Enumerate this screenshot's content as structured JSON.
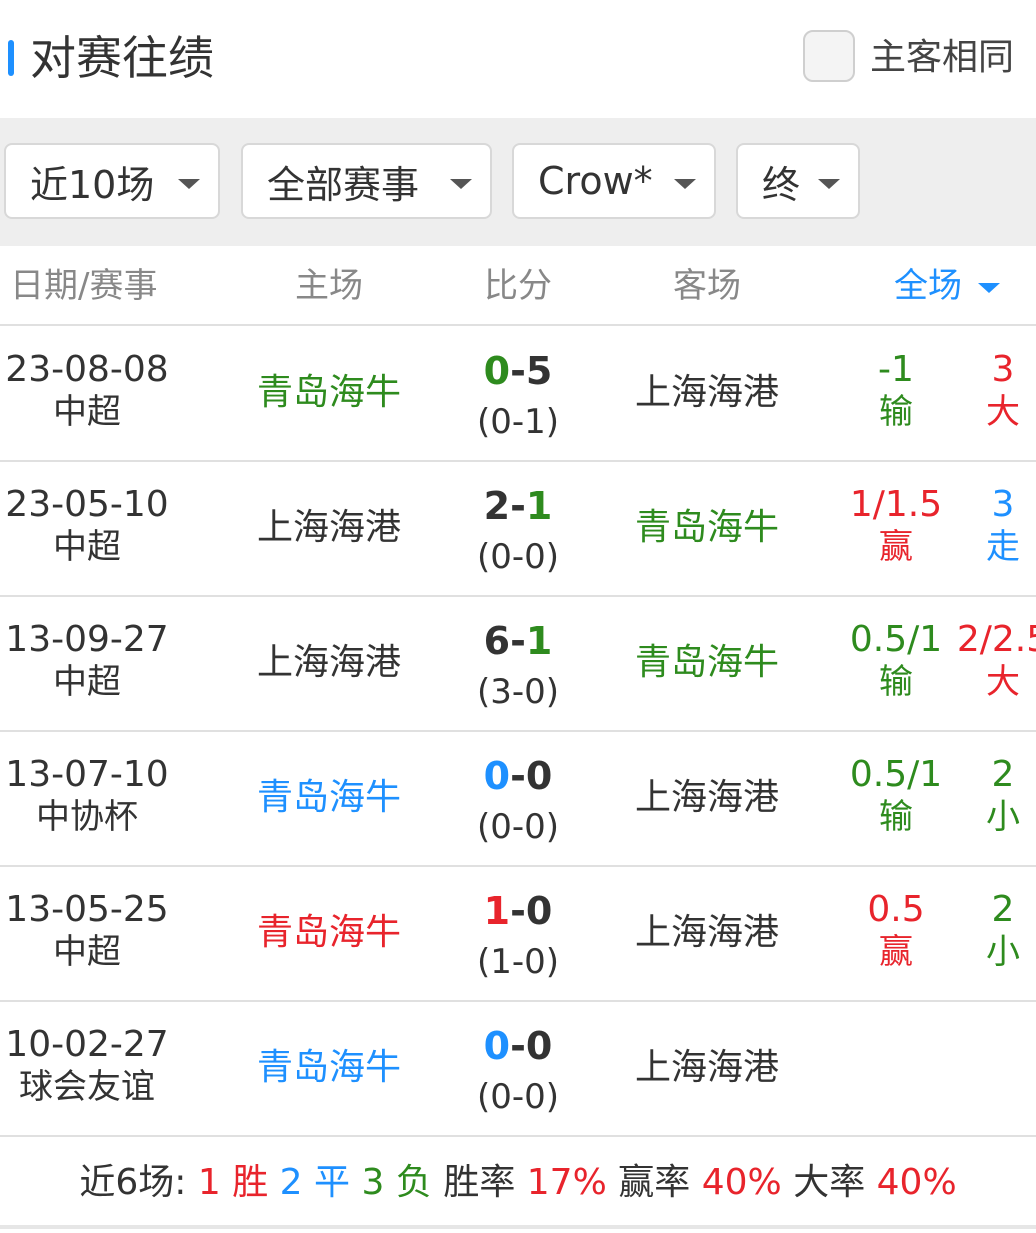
{
  "header": {
    "title": "对赛往绩",
    "checkbox_label": "主客相同"
  },
  "filters": {
    "count": "近10场",
    "competition": "全部赛事",
    "company": "Crow*",
    "odds_type": "终"
  },
  "table": {
    "columns": {
      "date_comp": "日期/赛事",
      "home": "主场",
      "score": "比分",
      "away": "客场",
      "period": "全场"
    },
    "rows": [
      {
        "date": "23-08-08",
        "comp": "中超",
        "home": "青岛海牛",
        "home_color": "#2e8b1e",
        "score_home": "0",
        "score_home_color": "#2e8b1e",
        "score_sep": "-",
        "score_away": "5",
        "score_away_color": "#333333",
        "half": "(0-1)",
        "away": "上海海港",
        "away_color": "#333333",
        "hcp": "-1",
        "hcp_color": "#2e8b1e",
        "hcp_result": "输",
        "hcp_result_color": "#2e8b1e",
        "ou": "3",
        "ou_color": "#e8242c",
        "ou_result": "大",
        "ou_result_color": "#e8242c"
      },
      {
        "date": "23-05-10",
        "comp": "中超",
        "home": "上海海港",
        "home_color": "#333333",
        "score_home": "2",
        "score_home_color": "#333333",
        "score_sep": "-",
        "score_away": "1",
        "score_away_color": "#2e8b1e",
        "half": "(0-0)",
        "away": "青岛海牛",
        "away_color": "#2e8b1e",
        "hcp": "1/1.5",
        "hcp_color": "#e8242c",
        "hcp_result": "赢",
        "hcp_result_color": "#e8242c",
        "ou": "3",
        "ou_color": "#1e90ff",
        "ou_result": "走",
        "ou_result_color": "#1e90ff"
      },
      {
        "date": "13-09-27",
        "comp": "中超",
        "home": "上海海港",
        "home_color": "#333333",
        "score_home": "6",
        "score_home_color": "#333333",
        "score_sep": "-",
        "score_away": "1",
        "score_away_color": "#2e8b1e",
        "half": "(3-0)",
        "away": "青岛海牛",
        "away_color": "#2e8b1e",
        "hcp": "0.5/1",
        "hcp_color": "#2e8b1e",
        "hcp_result": "输",
        "hcp_result_color": "#2e8b1e",
        "ou": "2/2.5",
        "ou_color": "#e8242c",
        "ou_result": "大",
        "ou_result_color": "#e8242c"
      },
      {
        "date": "13-07-10",
        "comp": "中协杯",
        "home": "青岛海牛",
        "home_color": "#1e90ff",
        "score_home": "0",
        "score_home_color": "#1e90ff",
        "score_sep": "-",
        "score_away": "0",
        "score_away_color": "#333333",
        "half": "(0-0)",
        "away": "上海海港",
        "away_color": "#333333",
        "hcp": "0.5/1",
        "hcp_color": "#2e8b1e",
        "hcp_result": "输",
        "hcp_result_color": "#2e8b1e",
        "ou": "2",
        "ou_color": "#2e8b1e",
        "ou_result": "小",
        "ou_result_color": "#2e8b1e"
      },
      {
        "date": "13-05-25",
        "comp": "中超",
        "home": "青岛海牛",
        "home_color": "#e8242c",
        "score_home": "1",
        "score_home_color": "#e8242c",
        "score_sep": "-",
        "score_away": "0",
        "score_away_color": "#333333",
        "half": "(1-0)",
        "away": "上海海港",
        "away_color": "#333333",
        "hcp": "0.5",
        "hcp_color": "#e8242c",
        "hcp_result": "赢",
        "hcp_result_color": "#e8242c",
        "ou": "2",
        "ou_color": "#2e8b1e",
        "ou_result": "小",
        "ou_result_color": "#2e8b1e"
      },
      {
        "date": "10-02-27",
        "comp": "球会友谊",
        "home": "青岛海牛",
        "home_color": "#1e90ff",
        "score_home": "0",
        "score_home_color": "#1e90ff",
        "score_sep": "-",
        "score_away": "0",
        "score_away_color": "#333333",
        "half": "(0-0)",
        "away": "上海海港",
        "away_color": "#333333",
        "hcp": "",
        "hcp_color": "#333333",
        "hcp_result": "",
        "hcp_result_color": "#333333",
        "ou": "",
        "ou_color": "#333333",
        "ou_result": "",
        "ou_result_color": "#333333"
      }
    ]
  },
  "summary": {
    "prefix": "近6场:",
    "win_count": "1",
    "win_label": "胜",
    "draw_count": "2",
    "draw_label": "平",
    "loss_count": "3",
    "loss_label": "负",
    "win_rate_label": "胜率",
    "win_rate": "17%",
    "hcp_rate_label": "赢率",
    "hcp_rate": "40%",
    "over_rate_label": "大率",
    "over_rate": "40%"
  },
  "colors": {
    "accent_blue": "#1e90ff",
    "win_red": "#e8242c",
    "loss_green": "#2e8b1e",
    "text_dark": "#333333"
  }
}
